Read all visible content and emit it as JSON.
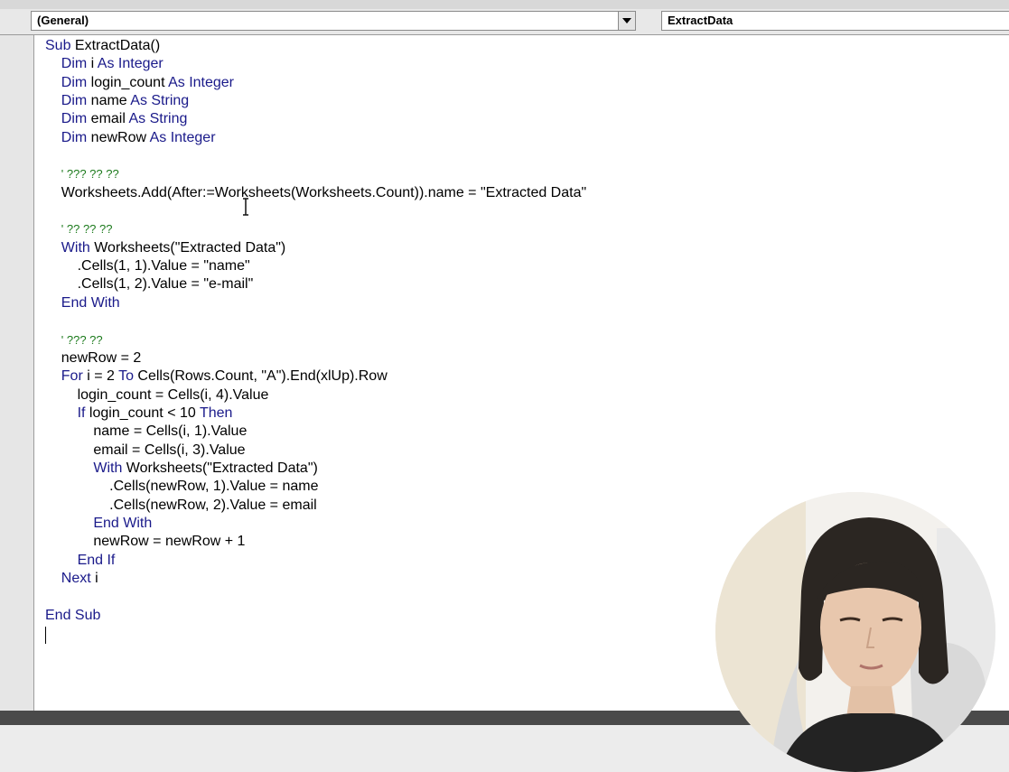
{
  "combos": {
    "object": "(General)",
    "procedure": "ExtractData"
  },
  "code_lines": [
    {
      "segments": [
        {
          "t": "Sub ",
          "k": "kw"
        },
        {
          "t": "ExtractData()",
          "k": ""
        }
      ]
    },
    {
      "segments": [
        {
          "t": "    Dim ",
          "k": "kw"
        },
        {
          "t": "i ",
          "k": ""
        },
        {
          "t": "As Integer",
          "k": "kw"
        }
      ]
    },
    {
      "segments": [
        {
          "t": "    Dim ",
          "k": "kw"
        },
        {
          "t": "login_count ",
          "k": ""
        },
        {
          "t": "As Integer",
          "k": "kw"
        }
      ]
    },
    {
      "segments": [
        {
          "t": "    Dim ",
          "k": "kw"
        },
        {
          "t": "name ",
          "k": ""
        },
        {
          "t": "As String",
          "k": "kw"
        }
      ]
    },
    {
      "segments": [
        {
          "t": "    Dim ",
          "k": "kw"
        },
        {
          "t": "email ",
          "k": ""
        },
        {
          "t": "As String",
          "k": "kw"
        }
      ]
    },
    {
      "segments": [
        {
          "t": "    Dim ",
          "k": "kw"
        },
        {
          "t": "newRow ",
          "k": ""
        },
        {
          "t": "As Integer",
          "k": "kw"
        }
      ]
    },
    {
      "segments": [
        {
          "t": "",
          "k": ""
        }
      ]
    },
    {
      "segments": [
        {
          "t": "    ",
          "k": ""
        },
        {
          "t": "' ??? ?? ??",
          "k": "cm"
        }
      ]
    },
    {
      "segments": [
        {
          "t": "    Worksheets.Add(After:=Worksheets(Worksheets.Count)).name = \"Extracted Data\"",
          "k": ""
        }
      ]
    },
    {
      "segments": [
        {
          "t": "",
          "k": ""
        }
      ]
    },
    {
      "segments": [
        {
          "t": "    ",
          "k": ""
        },
        {
          "t": "' ?? ?? ??",
          "k": "cm"
        }
      ]
    },
    {
      "segments": [
        {
          "t": "    With ",
          "k": "kw"
        },
        {
          "t": "Worksheets(\"Extracted Data\")",
          "k": ""
        }
      ]
    },
    {
      "segments": [
        {
          "t": "        .Cells(1, 1).Value = \"name\"",
          "k": ""
        }
      ]
    },
    {
      "segments": [
        {
          "t": "        .Cells(1, 2).Value = \"e-mail\"",
          "k": ""
        }
      ]
    },
    {
      "segments": [
        {
          "t": "    End With",
          "k": "kw"
        }
      ]
    },
    {
      "segments": [
        {
          "t": "",
          "k": ""
        }
      ]
    },
    {
      "segments": [
        {
          "t": "    ",
          "k": ""
        },
        {
          "t": "' ??? ??",
          "k": "cm"
        }
      ]
    },
    {
      "segments": [
        {
          "t": "    newRow = 2",
          "k": ""
        }
      ]
    },
    {
      "segments": [
        {
          "t": "    For ",
          "k": "kw"
        },
        {
          "t": "i = 2 ",
          "k": ""
        },
        {
          "t": "To ",
          "k": "kw"
        },
        {
          "t": "Cells(Rows.Count, \"A\").End(xlUp).Row",
          "k": ""
        }
      ]
    },
    {
      "segments": [
        {
          "t": "        login_count = Cells(i, 4).Value",
          "k": ""
        }
      ]
    },
    {
      "segments": [
        {
          "t": "        If ",
          "k": "kw"
        },
        {
          "t": "login_count < 10 ",
          "k": ""
        },
        {
          "t": "Then",
          "k": "kw"
        }
      ]
    },
    {
      "segments": [
        {
          "t": "            name = Cells(i, 1).Value",
          "k": ""
        }
      ]
    },
    {
      "segments": [
        {
          "t": "            email = Cells(i, 3).Value",
          "k": ""
        }
      ]
    },
    {
      "segments": [
        {
          "t": "            With ",
          "k": "kw"
        },
        {
          "t": "Worksheets(\"Extracted Data\")",
          "k": ""
        }
      ]
    },
    {
      "segments": [
        {
          "t": "                .Cells(newRow, 1).Value = name",
          "k": ""
        }
      ]
    },
    {
      "segments": [
        {
          "t": "                .Cells(newRow, 2).Value = email",
          "k": ""
        }
      ]
    },
    {
      "segments": [
        {
          "t": "            End With",
          "k": "kw"
        }
      ]
    },
    {
      "segments": [
        {
          "t": "            newRow = newRow + 1",
          "k": ""
        }
      ]
    },
    {
      "segments": [
        {
          "t": "        End If",
          "k": "kw"
        }
      ]
    },
    {
      "segments": [
        {
          "t": "    Next ",
          "k": "kw"
        },
        {
          "t": "i",
          "k": ""
        }
      ]
    },
    {
      "segments": [
        {
          "t": "",
          "k": ""
        }
      ]
    },
    {
      "segments": [
        {
          "t": "End Sub",
          "k": "kw"
        }
      ]
    }
  ],
  "colors": {
    "keyword": "#1a1a8a",
    "comment": "#1c7a1c",
    "text": "#000000"
  },
  "icons": [
    "chevron-down-icon",
    "text-cursor-icon"
  ]
}
